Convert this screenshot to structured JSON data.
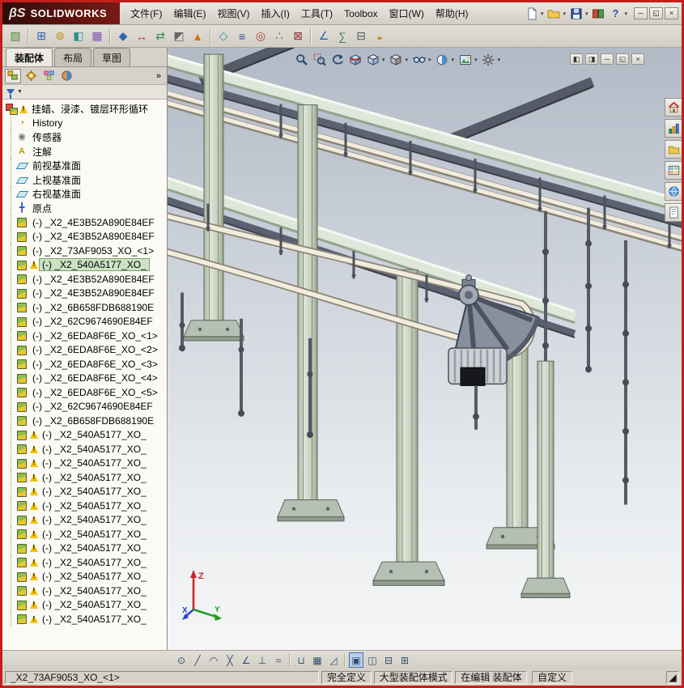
{
  "window": {
    "logo_mark": "βS",
    "logo_text": "SOLIDWORKS",
    "menus": [
      "文件(F)",
      "编辑(E)",
      "视图(V)",
      "插入(I)",
      "工具(T)",
      "Toolbox",
      "窗口(W)",
      "帮助(H)"
    ],
    "quick_icons": [
      "new-document",
      "open-document",
      "save-document",
      "view-toggle",
      "help"
    ],
    "controls": [
      "minimize",
      "restore",
      "close"
    ]
  },
  "toolbar": {
    "icons": [
      "edit-component",
      "insert-components",
      "mate",
      "component-preview",
      "linear-component-pattern",
      "smart-fasteners",
      "move-component",
      "rotate-component",
      "show-hidden-components",
      "assembly-features",
      "reference-geometry",
      "bill-of-materials",
      "exploded-view",
      "explode-line-sketch",
      "interference-detection",
      "measure",
      "mass-properties",
      "section-properties",
      "motion-study"
    ]
  },
  "command_tabs": [
    {
      "label": "装配体",
      "active": true
    },
    {
      "label": "布局",
      "active": false
    },
    {
      "label": "草图",
      "active": false
    }
  ],
  "panel": {
    "tabs": [
      "featuremanager",
      "propertymanager",
      "configurationmanager",
      "displaymanager"
    ],
    "expand_label": "»"
  },
  "tree": {
    "items": [
      {
        "icon": "assembly",
        "label": "挂蜡、浸漆、镀层环形循环",
        "warn": true,
        "root": true,
        "selected": false
      },
      {
        "icon": "history",
        "label": "History",
        "warn": false,
        "selected": false
      },
      {
        "icon": "sensor",
        "label": "传感器",
        "warn": false,
        "selected": false
      },
      {
        "icon": "annotation",
        "label": "注解",
        "warn": false,
        "selected": false
      },
      {
        "icon": "plane",
        "label": "前视基准面",
        "warn": false,
        "selected": false
      },
      {
        "icon": "plane",
        "label": "上视基准面",
        "warn": false,
        "selected": false
      },
      {
        "icon": "plane",
        "label": "右视基准面",
        "warn": false,
        "selected": false
      },
      {
        "icon": "origin",
        "label": "原点",
        "warn": false,
        "selected": false
      },
      {
        "icon": "part",
        "label": "(-) _X2_4E3B52A890E84EF",
        "warn": false,
        "selected": false
      },
      {
        "icon": "part",
        "label": "(-) _X2_4E3B52A890E84EF",
        "warn": false,
        "selected": false
      },
      {
        "icon": "part",
        "label": "(-) _X2_73AF9053_XO_<1>",
        "warn": false,
        "selected": false
      },
      {
        "icon": "part",
        "label": "(-) _X2_540A5177_XO_",
        "warn": true,
        "selected": true
      },
      {
        "icon": "part",
        "label": "(-) _X2_4E3B52A890E84EF",
        "warn": false,
        "selected": false
      },
      {
        "icon": "part",
        "label": "(-) _X2_4E3B52A890E84EF",
        "warn": false,
        "selected": false
      },
      {
        "icon": "part",
        "label": "(-) _X2_6B658FDB688190E",
        "warn": false,
        "selected": false
      },
      {
        "icon": "part",
        "label": "(-) _X2_62C9674690E84EF",
        "warn": false,
        "selected": false
      },
      {
        "icon": "part",
        "label": "(-) _X2_6EDA8F6E_XO_<1>",
        "warn": false,
        "selected": false
      },
      {
        "icon": "part",
        "label": "(-) _X2_6EDA8F6E_XO_<2>",
        "warn": false,
        "selected": false
      },
      {
        "icon": "part",
        "label": "(-) _X2_6EDA8F6E_XO_<3>",
        "warn": false,
        "selected": false
      },
      {
        "icon": "part",
        "label": "(-) _X2_6EDA8F6E_XO_<4>",
        "warn": false,
        "selected": false
      },
      {
        "icon": "part",
        "label": "(-) _X2_6EDA8F6E_XO_<5>",
        "warn": false,
        "selected": false
      },
      {
        "icon": "part",
        "label": "(-) _X2_62C9674690E84EF",
        "warn": false,
        "selected": false
      },
      {
        "icon": "part",
        "label": "(-) _X2_6B658FDB688190E",
        "warn": false,
        "selected": false
      },
      {
        "icon": "part",
        "label": "(-) _X2_540A5177_XO_",
        "warn": true,
        "selected": false
      },
      {
        "icon": "part",
        "label": "(-) _X2_540A5177_XO_",
        "warn": true,
        "selected": false
      },
      {
        "icon": "part",
        "label": "(-) _X2_540A5177_XO_",
        "warn": true,
        "selected": false
      },
      {
        "icon": "part",
        "label": "(-) _X2_540A5177_XO_",
        "warn": true,
        "selected": false
      },
      {
        "icon": "part",
        "label": "(-) _X2_540A5177_XO_",
        "warn": true,
        "selected": false
      },
      {
        "icon": "part",
        "label": "(-) _X2_540A5177_XO_",
        "warn": true,
        "selected": false
      },
      {
        "icon": "part",
        "label": "(-) _X2_540A5177_XO_",
        "warn": true,
        "selected": false
      },
      {
        "icon": "part",
        "label": "(-) _X2_540A5177_XO_",
        "warn": true,
        "selected": false
      },
      {
        "icon": "part",
        "label": "(-) _X2_540A5177_XO_",
        "warn": true,
        "selected": false
      },
      {
        "icon": "part",
        "label": "(-) _X2_540A5177_XO_",
        "warn": true,
        "selected": false
      },
      {
        "icon": "part",
        "label": "(-) _X2_540A5177_XO_",
        "warn": true,
        "selected": false
      },
      {
        "icon": "part",
        "label": "(-) _X2_540A5177_XO_",
        "warn": true,
        "selected": false
      },
      {
        "icon": "part",
        "label": "(-) _X2_540A5177_XO_",
        "warn": true,
        "selected": false
      },
      {
        "icon": "part",
        "label": "(-) _X2_540A5177_XO_",
        "warn": true,
        "selected": false
      }
    ]
  },
  "viewport": {
    "hud": [
      "zoom-fit",
      "zoom-area",
      "previous-view",
      "section-view",
      "view-orientation",
      "display-style",
      "hide-show-items",
      "edit-appearance",
      "apply-scene",
      "view-settings"
    ],
    "doc_controls": [
      "pane-left",
      "pane-right",
      "minimize-document",
      "restore-document",
      "close-document"
    ],
    "triad": {
      "x": "X",
      "y": "Y",
      "z": "Z"
    }
  },
  "task_pane": {
    "icons": [
      "solidworks-resources",
      "design-library",
      "file-explorer",
      "view-palette",
      "appearances-scenes",
      "custom-properties"
    ]
  },
  "bottom_toolbar": {
    "icons": [
      "point-snap",
      "line-snap",
      "arc-snap",
      "intersection-snap",
      "angle-snap",
      "perpendicular-snap",
      "spline-snap",
      "hv-snap",
      "grid-snap",
      "snap-angle",
      "single-viewport",
      "two-viewport-horizontal",
      "two-viewport-vertical",
      "four-viewport"
    ],
    "active": "single-viewport"
  },
  "statusbar": {
    "selected_item": "_X2_73AF9053_XO_<1>",
    "define_state": "完全定义",
    "assembly_mode": "大型装配体模式",
    "edit_state": "在编辑 装配体",
    "customize": "自定义"
  },
  "colors": {
    "window_border": "#c1201a",
    "selection_highlight": "#cde2c4",
    "rail_green": "#dfe7da",
    "pipe_cream": "#f2ecde",
    "steel_dark": "#5b6170"
  }
}
